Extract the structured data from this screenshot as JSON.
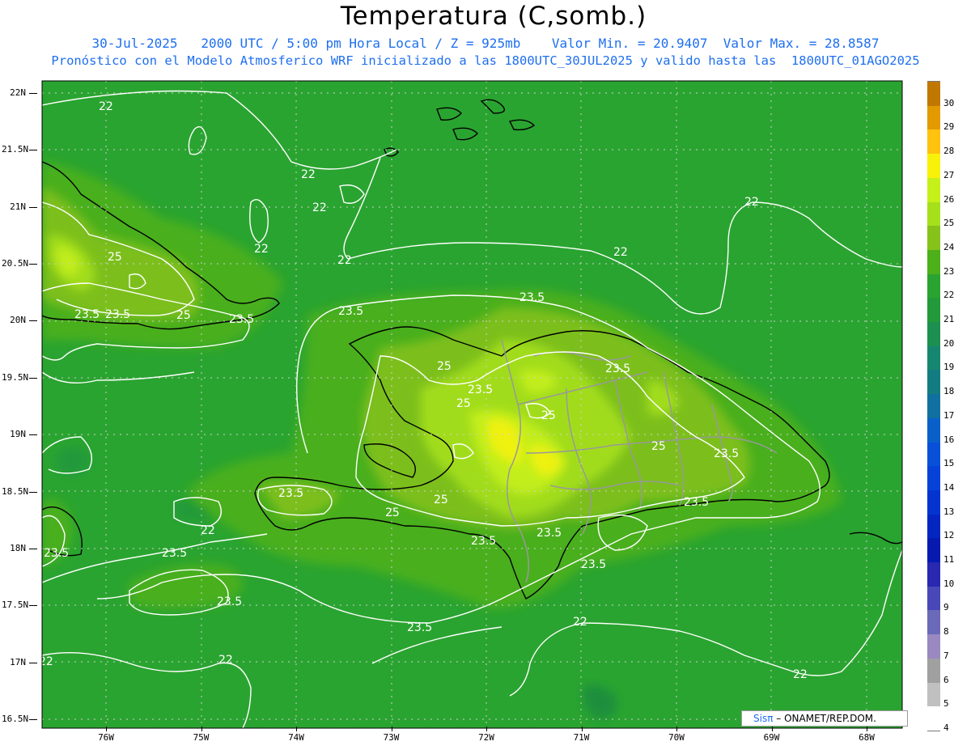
{
  "header": {
    "title": "Temperatura (C,somb.)",
    "line1": "30-Jul-2025   2000 UTC / 5:00 pm Hora Local / Z = 925mb    Valor Min. = 20.9407  Valor Max. = 28.8587",
    "line2": "Pronóstico con el Modelo Atmosferico WRF inicializado a las 1800UTC_30JUL2025 y valido hasta las  1800UTC_01AGO2025"
  },
  "axes": {
    "lat_labels": [
      "22N",
      "21.5N",
      "21N",
      "20.5N",
      "20N",
      "19.5N",
      "19N",
      "18.5N",
      "18N",
      "17.5N",
      "17N",
      "16.5N"
    ],
    "lon_labels": [
      "76W",
      "75W",
      "74W",
      "73W",
      "72W",
      "71W",
      "70W",
      "69W",
      "68W"
    ]
  },
  "colorbar": {
    "labels": [
      "30",
      "29",
      "28",
      "27",
      "26",
      "25",
      "24",
      "23",
      "22",
      "21",
      "20",
      "19",
      "18",
      "17",
      "16",
      "15",
      "14",
      "13",
      "12",
      "11",
      "10",
      "9",
      "8",
      "7",
      "6",
      "5",
      "4"
    ],
    "colors": [
      "#c07800",
      "#e29a00",
      "#ffc20e",
      "#f8f20a",
      "#c6f01a",
      "#a6e01a",
      "#86c21a",
      "#4cb01a",
      "#2aa430",
      "#229a3a",
      "#1c9050",
      "#168670",
      "#127c80",
      "#1070a0",
      "#0a60c8",
      "#0850d8",
      "#0642d8",
      "#0434d0",
      "#0426c0",
      "#061ab0",
      "#2828b0",
      "#4848b8",
      "#6a6ab8",
      "#9a88c0",
      "#a0a0a0",
      "#c0c0c0",
      "#ffffff"
    ]
  },
  "contours": {
    "levels": [
      {
        "label": "22",
        "labels_shown": 12
      },
      {
        "label": "23.5",
        "labels_shown": 17
      },
      {
        "label": "25",
        "labels_shown": 8
      }
    ]
  },
  "credit": {
    "sis": "Sisπ",
    "text": "– ONAMET/REP.DOM."
  },
  "map": {
    "fill_color": "#2aa430",
    "contour_color": "#ffffff",
    "coast_color": "#000000",
    "border_color": "#999999"
  }
}
